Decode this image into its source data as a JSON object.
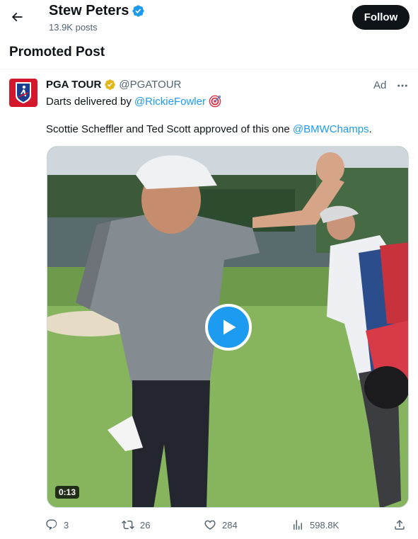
{
  "header": {
    "name": "Stew Peters",
    "posts": "13.9K posts",
    "follow_label": "Follow"
  },
  "section": {
    "title": "Promoted Post"
  },
  "tweet": {
    "author_name": "PGA TOUR",
    "author_handle": "@PGATOUR",
    "ad_label": "Ad",
    "line1_text": "Darts delivered by",
    "line1_mention": "@RickieFowler",
    "line2_text": "Scottie Scheffler and Ted Scott approved of this one",
    "line2_mention": "@BMWChamps",
    "line2_end": ".",
    "video_duration": "0:13"
  },
  "actions": {
    "replies": "3",
    "reposts": "26",
    "likes": "284",
    "views": "598.8K"
  },
  "icons": {
    "back": "arrow-left-icon",
    "verified_blue": "verified-blue-icon",
    "verified_gold": "verified-gold-icon",
    "more": "more-horizontal-icon",
    "target": "direct-hit-icon",
    "play": "play-icon",
    "reply": "reply-icon",
    "repost": "repost-icon",
    "like": "heart-icon",
    "views": "views-icon",
    "share": "share-icon"
  },
  "colors": {
    "accent": "#1d9bf0",
    "text": "#0f1419",
    "muted": "#536471",
    "gold_badge": "#e2b719",
    "pga_red": "#d5172d"
  }
}
